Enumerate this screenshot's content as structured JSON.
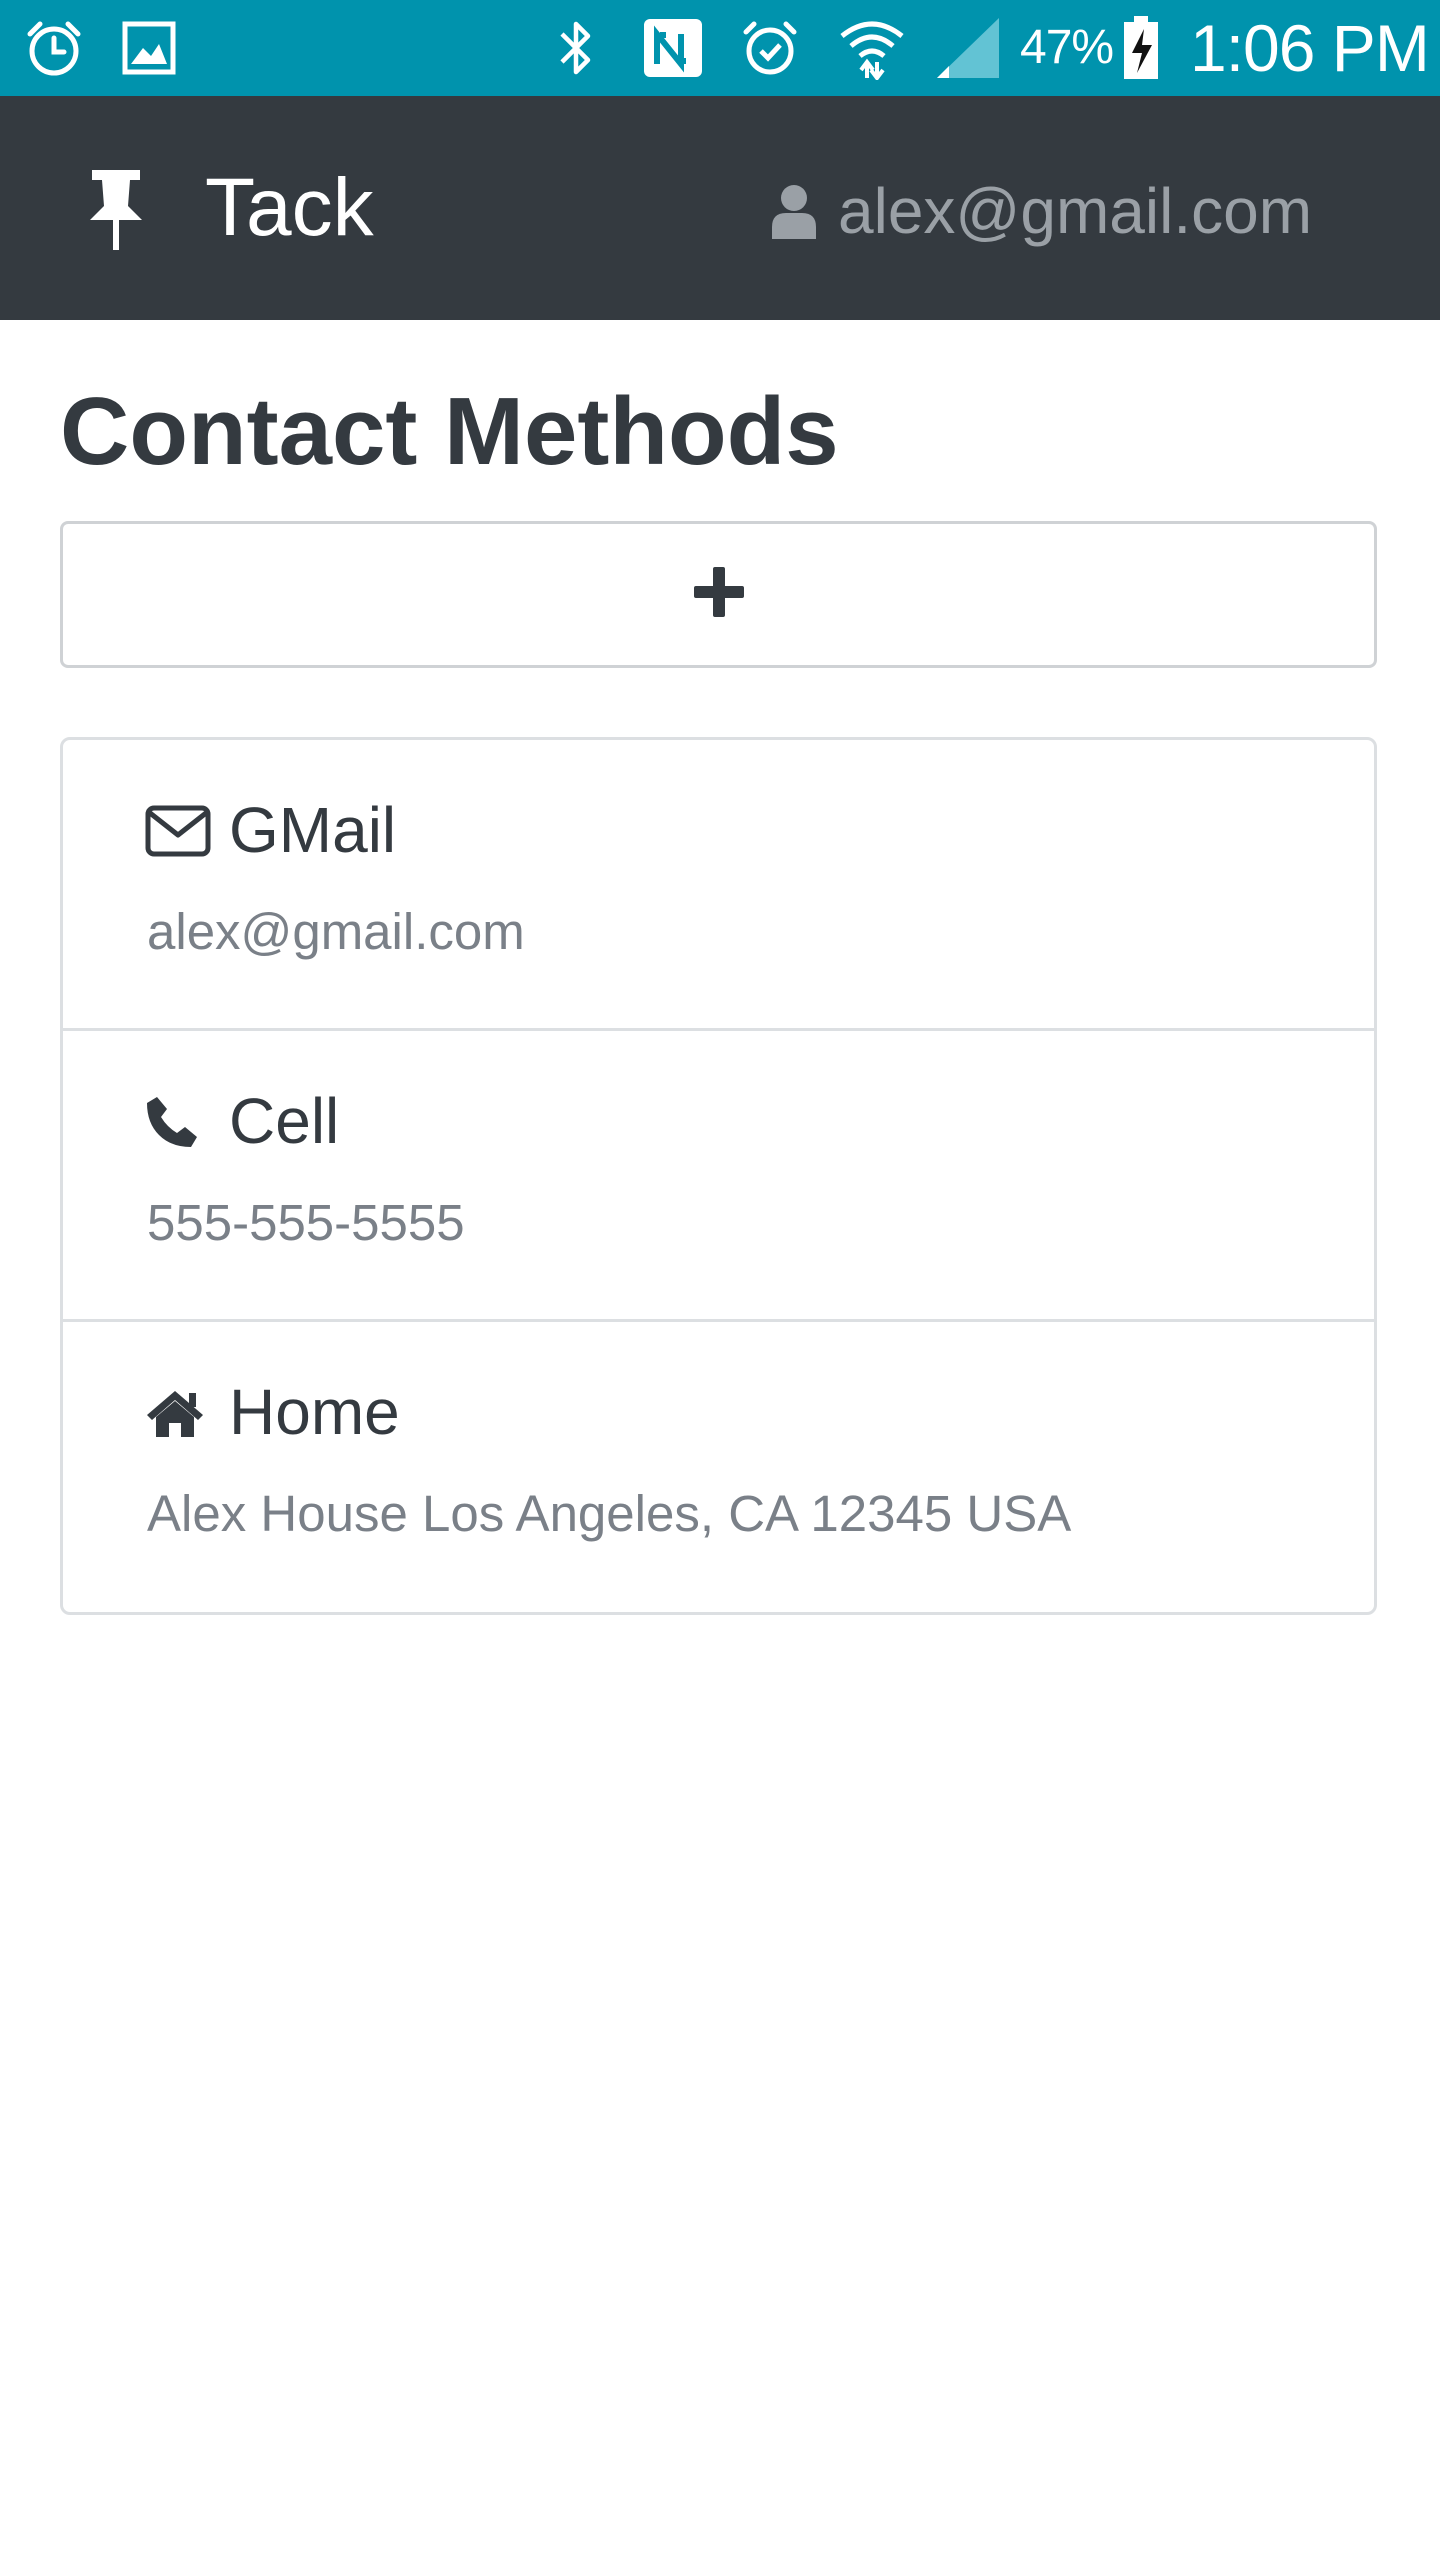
{
  "status_bar": {
    "battery_percent": "47%",
    "time": "1:06 PM",
    "icons": [
      "alarm-icon",
      "gallery-icon",
      "bluetooth-icon",
      "nfc-icon",
      "alarm-clock-icon",
      "wifi-icon",
      "signal-icon",
      "battery-charging-icon"
    ]
  },
  "navbar": {
    "brand_icon": "thumbtack-icon",
    "brand": "Tack",
    "user_icon": "user-icon",
    "user_email": "alex@gmail.com"
  },
  "main": {
    "title": "Contact Methods",
    "add_button_icon": "plus-icon",
    "contacts": [
      {
        "icon": "envelope-icon",
        "name": "GMail",
        "value": "alex@gmail.com"
      },
      {
        "icon": "phone-icon",
        "name": "Cell",
        "value": "555-555-5555"
      },
      {
        "icon": "home-icon",
        "name": "Home",
        "value": "Alex House Los Angeles, CA 12345 USA"
      }
    ]
  },
  "colors": {
    "status_bar": "#0093ad",
    "navbar": "#343a40",
    "text_dark": "#343a40",
    "text_muted": "#7a8088",
    "border": "#dcdfe2"
  }
}
